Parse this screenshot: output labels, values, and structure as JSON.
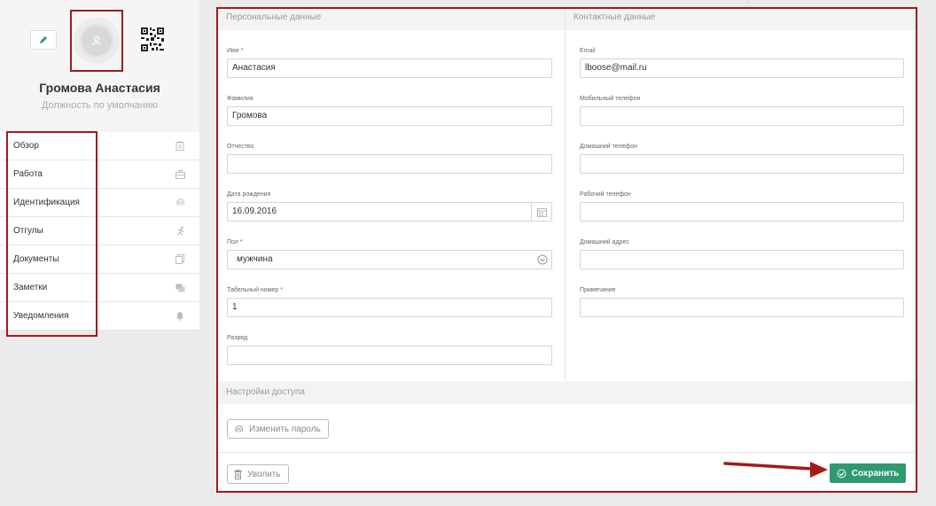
{
  "profile": {
    "name": "Громова Анастасия",
    "position": "Должность по умолчанию"
  },
  "menu": [
    {
      "label": "Обзор",
      "icon": "clipboard-icon"
    },
    {
      "label": "Работа",
      "icon": "briefcase-icon"
    },
    {
      "label": "Идентификация",
      "icon": "fingerprint-icon"
    },
    {
      "label": "Отгулы",
      "icon": "running-icon"
    },
    {
      "label": "Документы",
      "icon": "documents-icon"
    },
    {
      "label": "Заметки",
      "icon": "notes-icon"
    },
    {
      "label": "Уведомления",
      "icon": "bell-icon"
    }
  ],
  "personal": {
    "title": "Персональные данные",
    "first_name": {
      "label": "Имя *",
      "value": "Анастасия"
    },
    "last_name": {
      "label": "Фамилия",
      "value": "Громова"
    },
    "middle_name": {
      "label": "Отчество",
      "value": ""
    },
    "birth_date": {
      "label": "Дата рождения",
      "value": "16.09.2016"
    },
    "gender": {
      "label": "Пол *",
      "value": "мужчина"
    },
    "tab_number": {
      "label": "Табельный номер *",
      "value": "1"
    },
    "grade": {
      "label": "Разряд",
      "value": ""
    }
  },
  "contacts": {
    "title": "Контактные данные",
    "email": {
      "label": "Email",
      "value": "lboose@mail.ru"
    },
    "mobile": {
      "label": "Мобильный телефон",
      "value": ""
    },
    "home_phone": {
      "label": "Домашний телефон",
      "value": ""
    },
    "work_phone": {
      "label": "Рабочий телефон",
      "value": ""
    },
    "home_address": {
      "label": "Домашний адрес",
      "value": ""
    },
    "note": {
      "label": "Примечание",
      "value": ""
    }
  },
  "access": {
    "title": "Настройки доступа",
    "change_password": "Изменить пароль"
  },
  "footer": {
    "dismiss": "Уволить",
    "save": "Сохранить"
  },
  "colors": {
    "accent_green": "#2e9a6e",
    "highlight_red": "#a11b1b"
  }
}
